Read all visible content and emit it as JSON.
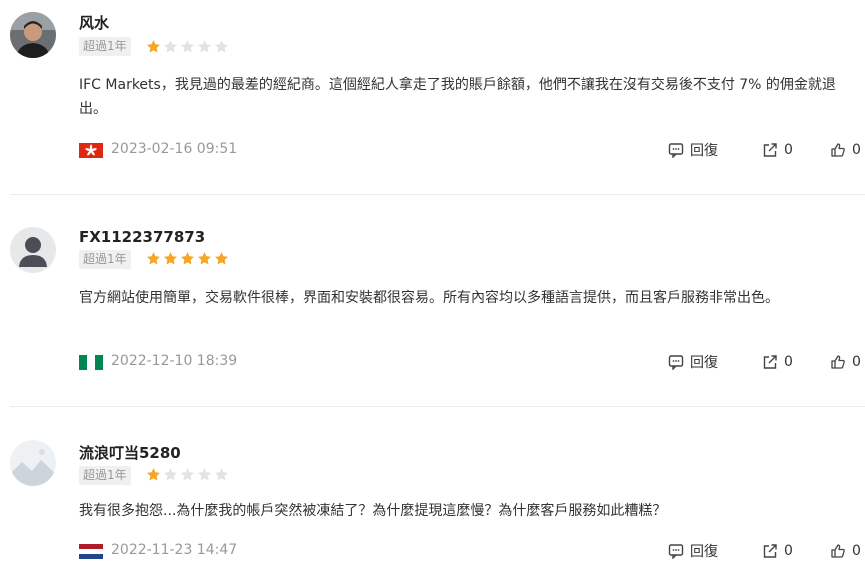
{
  "reviews": [
    {
      "username": "风水",
      "badge": "超過1年",
      "rating": 1,
      "content": "IFC Markets，我見過的最差的經紀商。這個經紀人拿走了我的賬戶餘額，他們不讓我在沒有交易後不支付 7% 的佣金就退出。",
      "flag_icon": "hong-kong-flag-icon",
      "date": "2023-02-16 09:51",
      "reply_label": "回復",
      "share_count": "0",
      "like_count": "0"
    },
    {
      "username": "FX1122377873",
      "badge": "超過1年",
      "rating": 5,
      "content": "官方網站使用簡單，交易軟件很棒，界面和安裝都很容易。所有內容均以多種語言提供，而且客戶服務非常出色。",
      "flag_icon": "nigeria-flag-icon",
      "date": "2022-12-10 18:39",
      "reply_label": "回復",
      "share_count": "0",
      "like_count": "0"
    },
    {
      "username": "流浪叮当5280",
      "badge": "超過1年",
      "rating": 1,
      "content": "我有很多抱怨...為什麼我的帳戶突然被凍結了？為什麼提現這麼慢？為什麼客戶服務如此糟糕？",
      "flag_icon": "netherlands-flag-icon",
      "date": "2022-11-23 14:47",
      "reply_label": "回復",
      "share_count": "0",
      "like_count": "0"
    }
  ],
  "colors": {
    "star_active": "#f5a623",
    "star_inactive": "#e3e3e3",
    "muted_text": "#999999",
    "badge_bg": "#f0f0f0"
  }
}
